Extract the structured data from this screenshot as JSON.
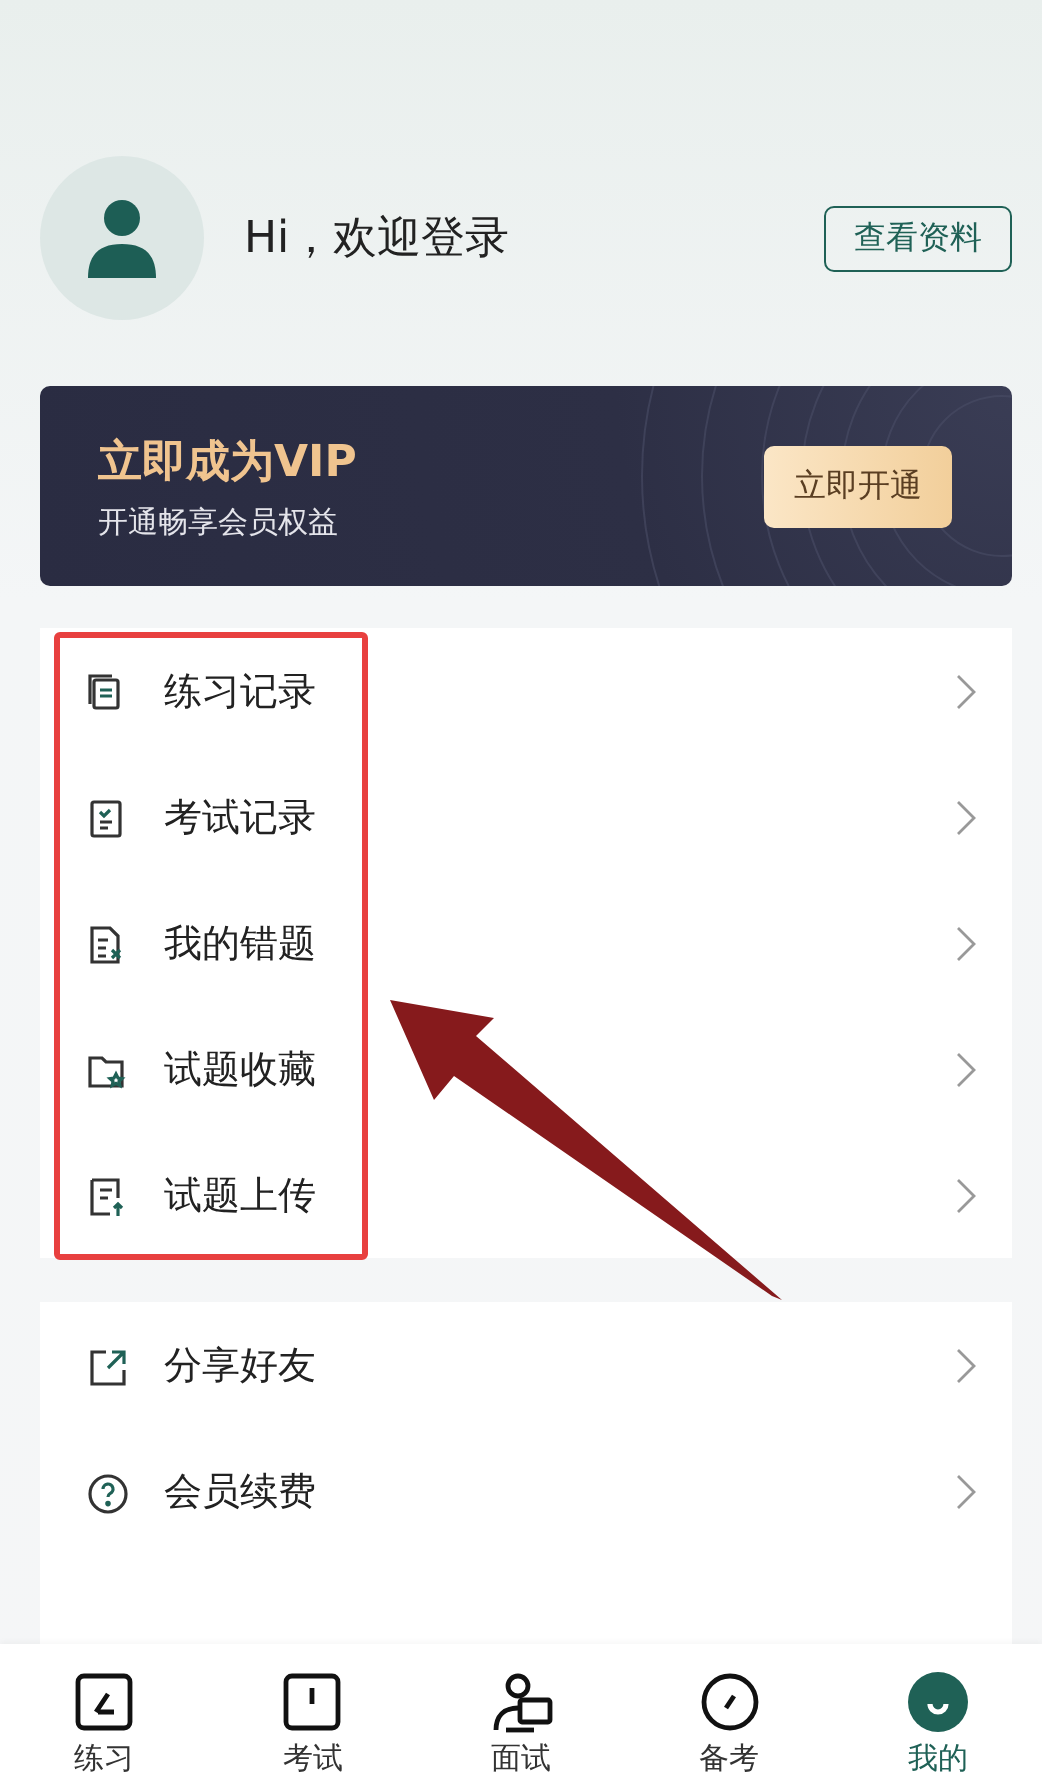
{
  "profile": {
    "greeting": "Hi，欢迎登录",
    "button": "查看资料"
  },
  "vip": {
    "title": "立即成为VIP",
    "subtitle": "开通畅享会员权益",
    "button": "立即开通"
  },
  "menu_groups": [
    {
      "highlighted": true,
      "items": [
        {
          "label": "练习记录"
        },
        {
          "label": "考试记录"
        },
        {
          "label": "我的错题"
        },
        {
          "label": "试题收藏"
        },
        {
          "label": "试题上传"
        }
      ]
    },
    {
      "highlighted": false,
      "items": [
        {
          "label": "分享好友"
        },
        {
          "label": "会员续费"
        }
      ]
    }
  ],
  "tabs": [
    {
      "label": "练习",
      "selected": false
    },
    {
      "label": "考试",
      "selected": false
    },
    {
      "label": "面试",
      "selected": false
    },
    {
      "label": "备考",
      "selected": false
    },
    {
      "label": "我的",
      "selected": true
    }
  ]
}
